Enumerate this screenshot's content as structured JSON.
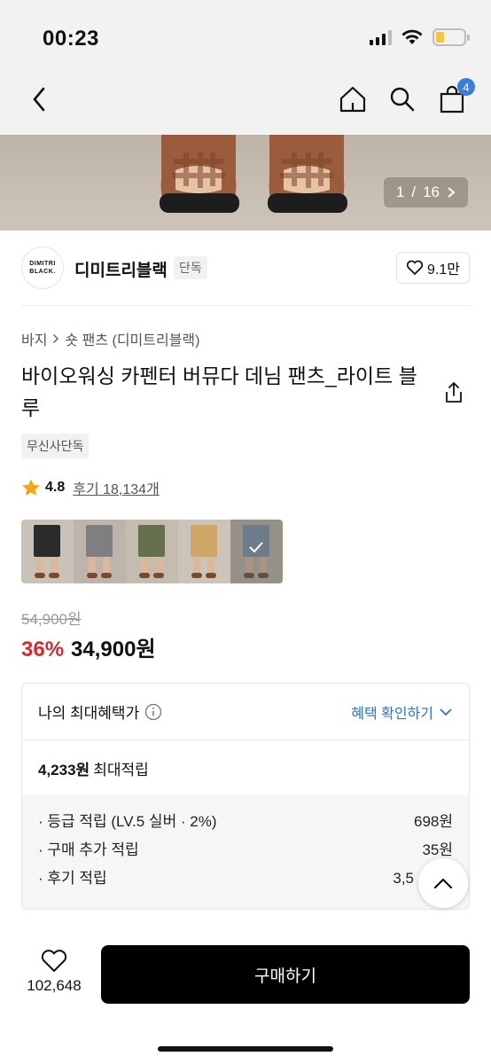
{
  "status_bar": {
    "time": "00:23",
    "battery_color": "#f5c542"
  },
  "nav": {
    "cart_count": "4"
  },
  "hero": {
    "page_current": "1",
    "page_total": "16",
    "page_separator": "/"
  },
  "brand": {
    "logo_line1": "DIMITRI",
    "logo_line2": "BLACK.",
    "name": "디미트리블랙",
    "tag": "단독",
    "likes": "9.1만"
  },
  "product": {
    "breadcrumb": [
      "바지",
      "숏 팬츠 (디미트리블랙)"
    ],
    "title": "바이오워싱 카펜터 버뮤다 데님 팬츠_라이트 블루",
    "exclusive_tag": "무신사단독",
    "rating": "4.8",
    "reviews": "후기 18,134개",
    "color_options": [
      {
        "name": "black",
        "shorts_color": "#2b2b2b",
        "bg": "#c9c2b8"
      },
      {
        "name": "grey-wash",
        "shorts_color": "#7d7f80",
        "bg": "#bdb5ab"
      },
      {
        "name": "khaki",
        "shorts_color": "#66704f",
        "bg": "#c4bcb0"
      },
      {
        "name": "beige",
        "shorts_color": "#cfa665",
        "bg": "#ccc4b8"
      },
      {
        "name": "light-blue",
        "shorts_color": "#7f93a8",
        "bg": "#bab2a7"
      }
    ]
  },
  "price": {
    "original": "54,900원",
    "discount": "36%",
    "final": "34,900원",
    "discount_color": "#e0262d"
  },
  "benefit": {
    "title": "나의 최대혜택가",
    "link": "혜택 확인하기",
    "total": "4,233원",
    "total_suffix": "최대적립",
    "items": [
      {
        "label": "· 등급 적립 (LV.5 실버 · 2%)",
        "value": "698원"
      },
      {
        "label": "· 구매 추가 적립",
        "value": "35원"
      },
      {
        "label": "· 후기 적립",
        "value": "3,5"
      }
    ]
  },
  "bottom": {
    "wish_count": "102,648",
    "buy_label": "구매하기"
  }
}
